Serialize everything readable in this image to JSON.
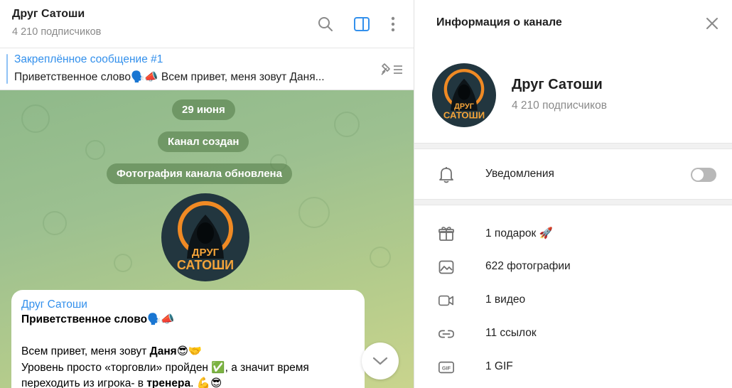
{
  "chat": {
    "title": "Друг Сатоши",
    "subscribers": "4 210 подписчиков"
  },
  "pinned": {
    "title": "Закреплённое сообщение #1",
    "text": "Приветственное слово🗣️📣  Всем привет, меня зовут Даня..."
  },
  "service_messages": {
    "date": "29 июня",
    "created": "Канал создан",
    "photo_updated": "Фотография канала обновлена"
  },
  "avatar_text": {
    "line1": "ДРУГ",
    "line2": "САТОШИ"
  },
  "message": {
    "author": "Друг Сатоши",
    "heading": "Приветственное слово🗣️📣",
    "line1_prefix": "Всем привет, меня зовут ",
    "line1_bold": "Даня",
    "line1_suffix": "😎🤝",
    "line2": "Уровень просто  «торговли» пройден ✅, а значит время",
    "line3_prefix": "переходить из игрока- в ",
    "line3_bold": "тренера",
    "line3_suffix": ". 💪😎"
  },
  "info": {
    "panel_title": "Информация о канале",
    "name": "Друг Сатоши",
    "subscribers": "4 210 подписчиков",
    "notifications_label": "Уведомления",
    "notifications_on": false,
    "rows": [
      {
        "icon": "gift-icon",
        "label": "1 подарок 🚀"
      },
      {
        "icon": "photo-icon",
        "label": "622 фотографии"
      },
      {
        "icon": "video-icon",
        "label": "1 видео"
      },
      {
        "icon": "link-icon",
        "label": "11 ссылок"
      },
      {
        "icon": "gif-icon",
        "label": "1 GIF"
      }
    ]
  },
  "colors": {
    "accent": "#3390ec",
    "avatar_bg": "#22363f",
    "avatar_ring": "#f08a24",
    "avatar_text": "#f4a43a"
  }
}
